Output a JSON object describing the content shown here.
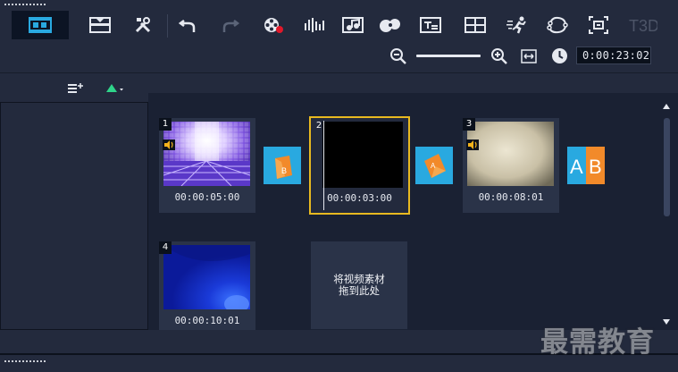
{
  "toolbar": {
    "buttons": [
      {
        "name": "storyboard-view-icon",
        "active": true
      },
      {
        "name": "timeline-view-icon"
      },
      {
        "name": "tools-icon"
      },
      {
        "name": "undo-icon"
      },
      {
        "name": "redo-icon"
      },
      {
        "name": "record-capture-icon"
      },
      {
        "name": "sound-mixer-icon"
      },
      {
        "name": "auto-music-icon"
      },
      {
        "name": "motion-tracking-icon"
      },
      {
        "name": "subtitle-editor-icon"
      },
      {
        "name": "multi-camera-icon"
      },
      {
        "name": "time-remapping-icon"
      },
      {
        "name": "mask-creator-icon"
      },
      {
        "name": "pan-zoom-icon"
      },
      {
        "name": "3d-title-icon"
      }
    ],
    "title3d_label": "T3D"
  },
  "zoom": {
    "timecode": "0:00:23:02"
  },
  "storyboard": {
    "clips": [
      {
        "number": "1",
        "duration": "00:00:05:00",
        "has_audio": true
      },
      {
        "number": "2",
        "duration": "00:00:03:00",
        "has_audio": false,
        "selected": true
      },
      {
        "number": "3",
        "duration": "00:00:08:01",
        "has_audio": true
      },
      {
        "number": "4",
        "duration": "00:00:10:01",
        "has_audio": false
      }
    ],
    "drop_zone_text": "将视频素材拖到此处"
  },
  "watermark": "最需教育",
  "colors": {
    "background": "#232a3d",
    "storyboard_bg": "#1a2133",
    "clip_bg": "#2a3348",
    "selection": "#e8b920",
    "transition": "#29a9e0",
    "record_dot": "#e0182a"
  }
}
